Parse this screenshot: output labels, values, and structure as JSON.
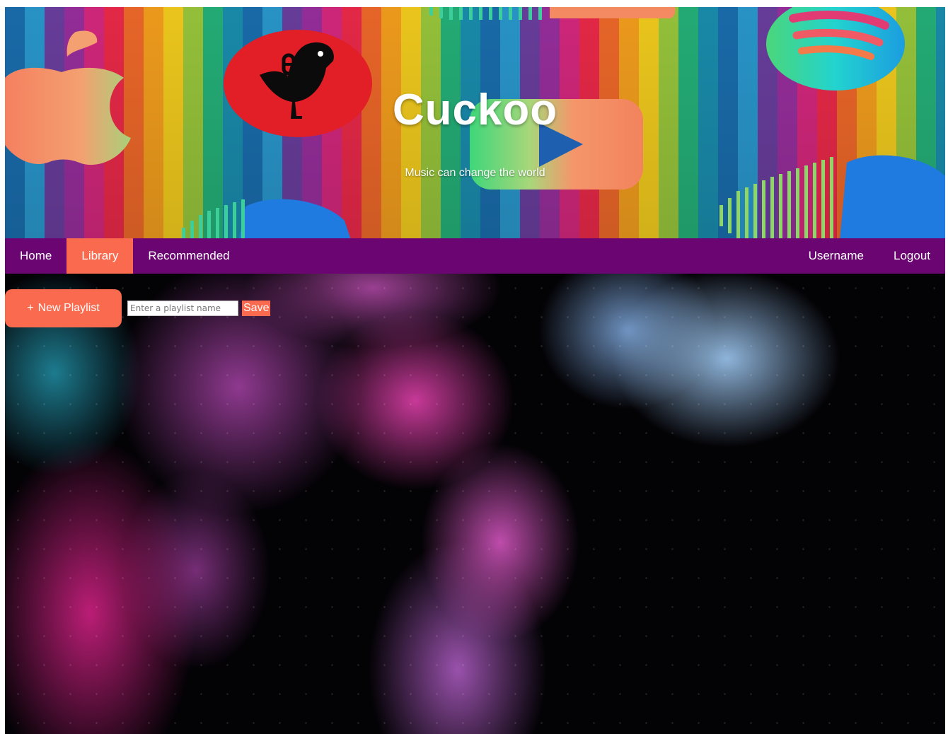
{
  "header": {
    "title": "Cuckoo",
    "subtitle": "Music can change the world"
  },
  "nav": {
    "left_items": [
      {
        "label": "Home",
        "active": false
      },
      {
        "label": "Library",
        "active": true
      },
      {
        "label": "Recommended",
        "active": false
      }
    ],
    "right_items": [
      {
        "label": "Username"
      },
      {
        "label": "Logout"
      }
    ]
  },
  "library": {
    "new_playlist_icon": "+",
    "new_playlist_label": "New Playlist",
    "playlist_input_placeholder": "Enter a playlist name",
    "playlist_input_value": "",
    "save_label": "Save"
  },
  "colors": {
    "nav_background": "#6a0572",
    "accent": "#f96a4e",
    "text_on_dark": "#ffffff"
  },
  "icons": {
    "brand_logo": "cuckoo-bird-icon",
    "decorative": [
      "apple-icon",
      "youtube-play-icon",
      "spotify-icon",
      "soundcloud-icon"
    ]
  }
}
